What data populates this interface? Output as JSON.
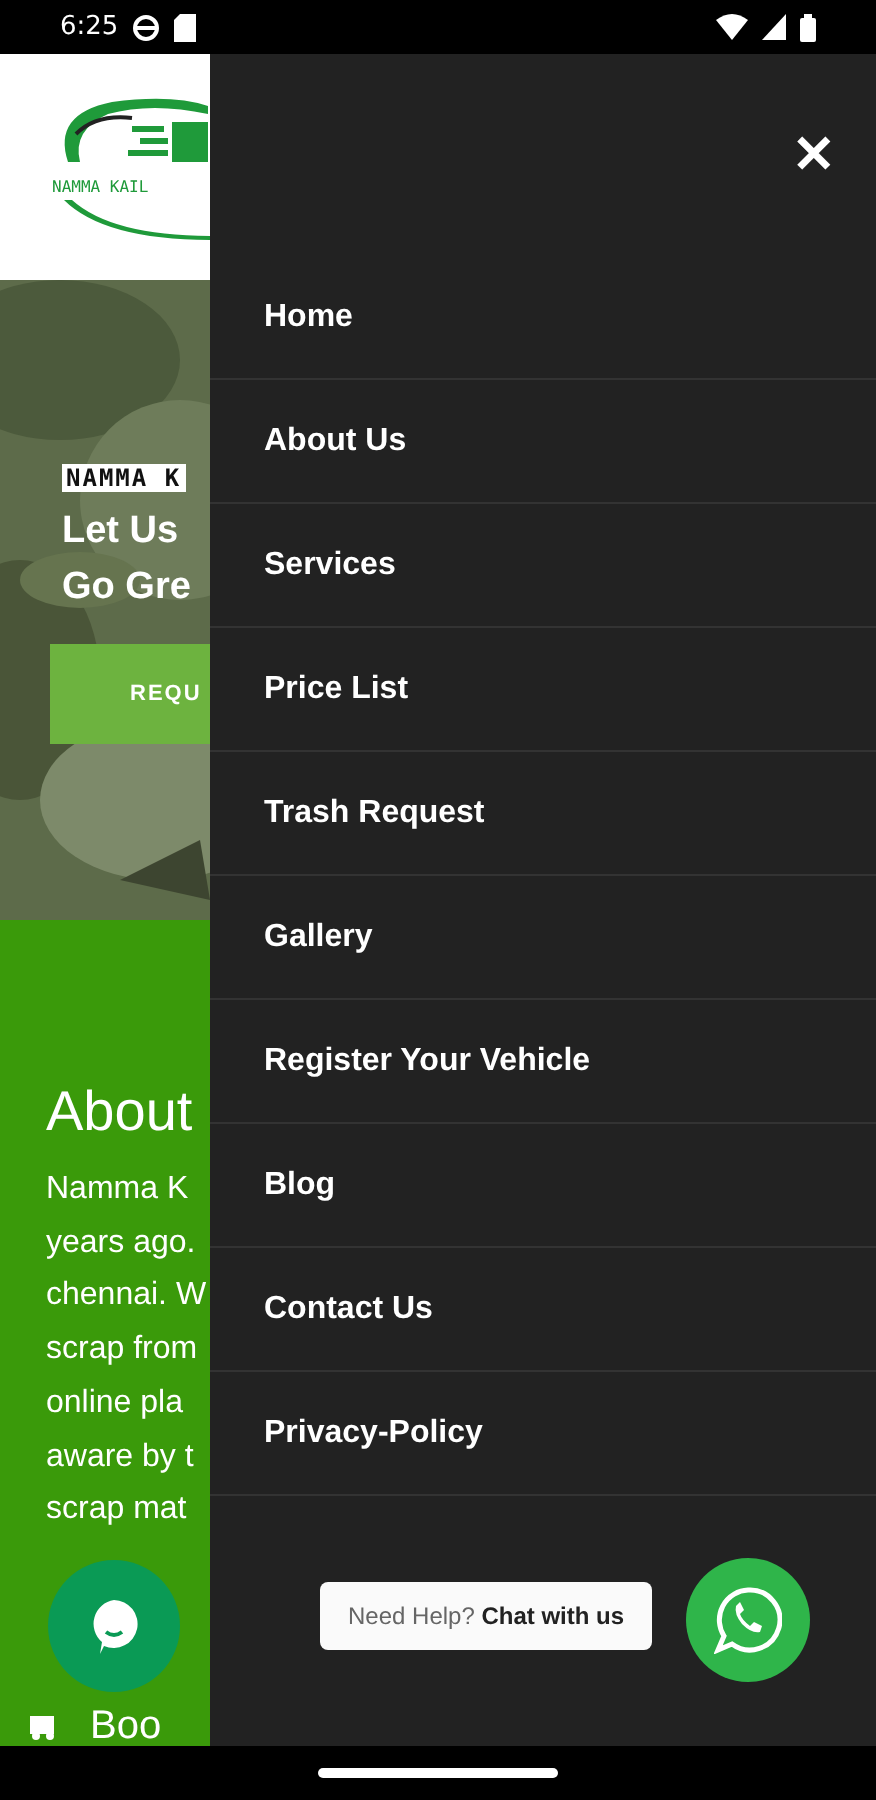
{
  "status_bar": {
    "time": "6:25"
  },
  "page": {
    "logo_text": "NAMMA KAIL",
    "hero": {
      "tag": "NAMMA K",
      "headline": [
        "Let Us",
        "Go Gre"
      ],
      "button": "REQU"
    },
    "about": {
      "title": "About",
      "lines": [
        "Namma K",
        "years ago.",
        "chennai. W",
        "scrap from",
        "online pla",
        "aware by t",
        "scrap mat"
      ]
    },
    "footer_item": "Boo"
  },
  "drawer": {
    "close": "✕",
    "items": [
      {
        "label": "Home"
      },
      {
        "label": "About Us"
      },
      {
        "label": "Services"
      },
      {
        "label": "Price List"
      },
      {
        "label": "Trash Request"
      },
      {
        "label": "Gallery"
      },
      {
        "label": "Register Your Vehicle"
      },
      {
        "label": "Blog"
      },
      {
        "label": "Contact Us"
      },
      {
        "label": "Privacy-Policy"
      }
    ]
  },
  "help": {
    "text": "Need Help? **Chat with us**"
  }
}
